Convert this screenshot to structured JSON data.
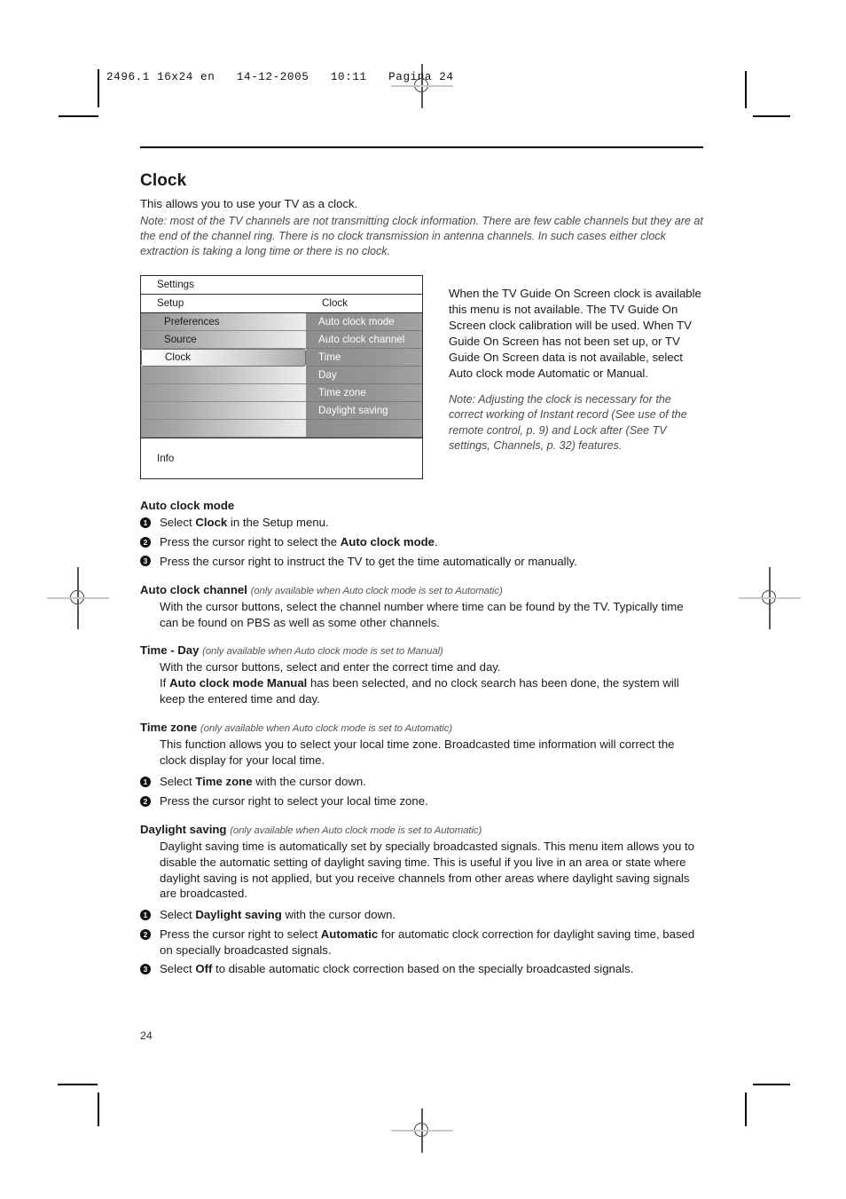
{
  "print": {
    "job_header": "2496.1 16x24 en   14-12-2005   10:11   Pagina 24",
    "page_number": "24"
  },
  "document": {
    "title": "Clock",
    "lead": "This allows you to use your TV as a clock.",
    "note": "Note: most of the TV channels are not transmitting clock information. There are few cable channels but they are at the end of the channel ring. There is no clock transmission in antenna channels. In such cases either clock extraction is taking a long time or there is no clock."
  },
  "tv_menu": {
    "title": "Settings",
    "column_headers": {
      "left": "Setup",
      "right": "Clock"
    },
    "left_items": [
      "Preferences",
      "Source",
      "Clock"
    ],
    "left_selected": "Clock",
    "left_blank_rows": 4,
    "right_items": [
      "Auto clock mode",
      "Auto clock channel",
      "Time",
      "Day",
      "Time zone",
      "Daylight saving"
    ],
    "right_blank_rows": 1,
    "info_label": "Info"
  },
  "side": {
    "paragraph": "When the TV Guide On Screen clock is available this menu is not available. The TV Guide On Screen clock calibration will be used. When TV Guide On Screen has not been set up, or TV Guide On Screen data is not available, select Auto clock mode Automatic or Manual.",
    "note": "Note: Adjusting the clock is necessary for the correct working of Instant record (See use of the remote control, p. 9) and Lock after (See TV settings, Channels, p. 32) features."
  },
  "sections": {
    "auto_clock_mode": {
      "heading": "Auto clock mode",
      "steps": [
        {
          "num": "1",
          "pre": "Select ",
          "bold": "Clock",
          "post": " in the Setup menu."
        },
        {
          "num": "2",
          "pre": "Press the cursor right to select the ",
          "bold": "Auto clock mode",
          "post": "."
        },
        {
          "num": "3",
          "pre": "Press the cursor right to instruct the TV to get the time automatically or manually.",
          "bold": "",
          "post": ""
        }
      ]
    },
    "auto_clock_channel": {
      "heading": "Auto clock channel",
      "condition": "(only available when Auto clock mode is set to Automatic)",
      "body": "With the cursor buttons, select the channel number where time can be found by the TV. Typically time can be found on PBS as well as some other channels."
    },
    "time_day": {
      "heading": "Time - Day",
      "condition": "(only available when Auto clock mode is set to Manual)",
      "body_line1": "With the cursor buttons, select and enter the correct time and day.",
      "body_line2_pre": "If ",
      "body_line2_bold": "Auto clock mode Manual",
      "body_line2_post": " has been selected, and no clock search has been done, the system will keep the entered time and day."
    },
    "time_zone": {
      "heading": "Time zone",
      "condition": "(only available when Auto clock mode is set to Automatic)",
      "body": "This function allows you to select your local time zone. Broadcasted time information will correct the clock display for your local time.",
      "steps": [
        {
          "num": "1",
          "pre": "Select ",
          "bold": "Time zone",
          "post": " with the cursor down."
        },
        {
          "num": "2",
          "pre": "Press the cursor right to select your local time zone.",
          "bold": "",
          "post": ""
        }
      ]
    },
    "daylight_saving": {
      "heading": "Daylight saving",
      "condition": "(only available when Auto clock mode is set to Automatic)",
      "body": "Daylight saving time is automatically set by specially broadcasted signals. This menu item allows you to disable the automatic setting of daylight saving time. This is useful if you live in an area or state where daylight saving is not applied, but you receive channels from other areas where daylight saving signals are broadcasted.",
      "steps": [
        {
          "num": "1",
          "pre": "Select ",
          "bold": "Daylight saving",
          "post": " with the cursor down."
        },
        {
          "num": "2",
          "pre": "Press the cursor right to select ",
          "bold": "Automatic",
          "post": " for automatic clock correction for daylight saving time, based on specially broadcasted signals."
        },
        {
          "num": "3",
          "pre": "Select ",
          "bold": "Off",
          "post": " to disable automatic clock correction based on the specially broadcasted signals."
        }
      ]
    }
  }
}
